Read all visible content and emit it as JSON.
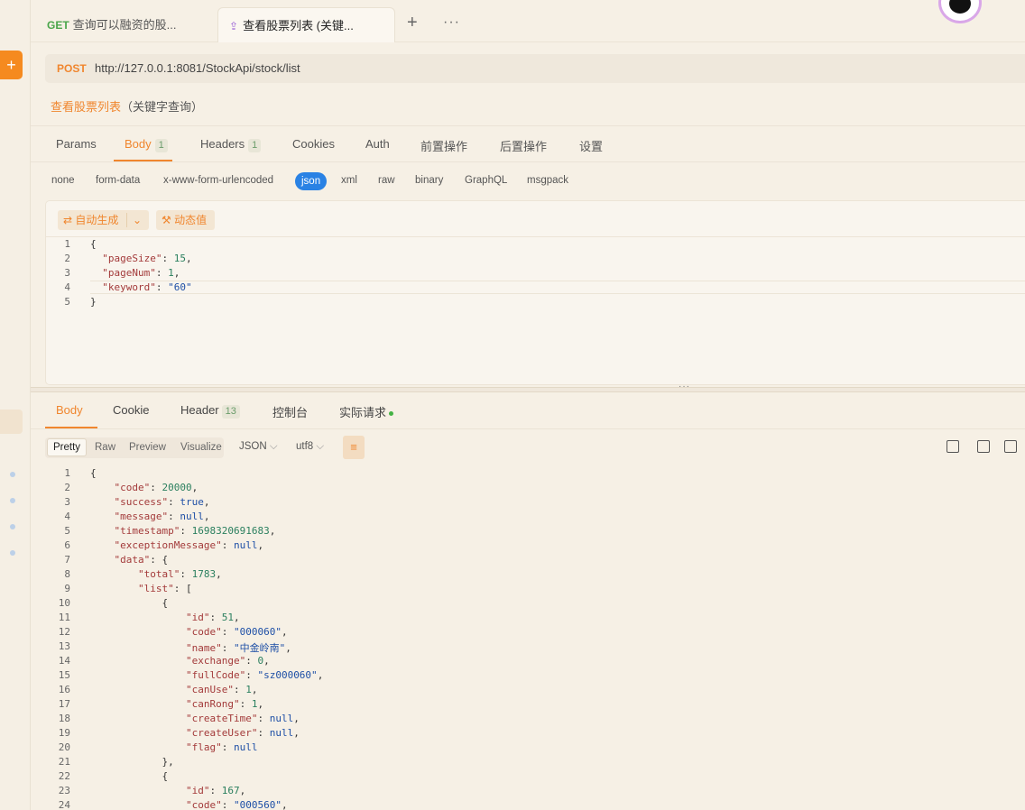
{
  "tabs": [
    {
      "method": "GET",
      "label": "查询可以融资的股..."
    },
    {
      "label": "查看股票列表 (关键..."
    }
  ],
  "request": {
    "method": "POST",
    "url": "http://127.0.0.1:8081/StockApi/stock/list",
    "name": "查看股票列表",
    "subtitle": "（关键字查询）"
  },
  "req_tabs": [
    {
      "label": "Params"
    },
    {
      "label": "Body",
      "count": "1"
    },
    {
      "label": "Headers",
      "count": "1"
    },
    {
      "label": "Cookies"
    },
    {
      "label": "Auth"
    },
    {
      "label": "前置操作"
    },
    {
      "label": "后置操作"
    },
    {
      "label": "设置"
    }
  ],
  "body_types": [
    "none",
    "form-data",
    "x-www-form-urlencoded",
    "json",
    "xml",
    "raw",
    "binary",
    "GraphQL",
    "msgpack"
  ],
  "editor": {
    "auto_gen": "自动生成",
    "dynamic": "动态值"
  },
  "request_body": [
    "{",
    "  \"pageSize\": 15,",
    "  \"pageNum\": 1,",
    "  \"keyword\": \"60\"",
    "}"
  ],
  "resp_tabs": [
    {
      "label": "Body"
    },
    {
      "label": "Cookie"
    },
    {
      "label": "Header",
      "count": "13"
    },
    {
      "label": "控制台"
    },
    {
      "label": "实际请求"
    }
  ],
  "view_modes": [
    "Pretty",
    "Raw",
    "Preview",
    "Visualize"
  ],
  "format_select": "JSON",
  "encoding_select": "utf8",
  "response_body": [
    "{",
    "    \"code\": 20000,",
    "    \"success\": true,",
    "    \"message\": null,",
    "    \"timestamp\": 1698320691683,",
    "    \"exceptionMessage\": null,",
    "    \"data\": {",
    "        \"total\": 1783,",
    "        \"list\": [",
    "            {",
    "                \"id\": 51,",
    "                \"code\": \"000060\",",
    "                \"name\": \"中金岭南\",",
    "                \"exchange\": 0,",
    "                \"fullCode\": \"sz000060\",",
    "                \"canUse\": 1,",
    "                \"canRong\": 1,",
    "                \"createTime\": null,",
    "                \"createUser\": null,",
    "                \"flag\": null",
    "            },",
    "            {",
    "                \"id\": 167,",
    "                \"code\": \"000560\","
  ],
  "colors": {
    "accent": "#f0862e",
    "selected": "#2a82e4",
    "background": "#f6f0e5"
  }
}
